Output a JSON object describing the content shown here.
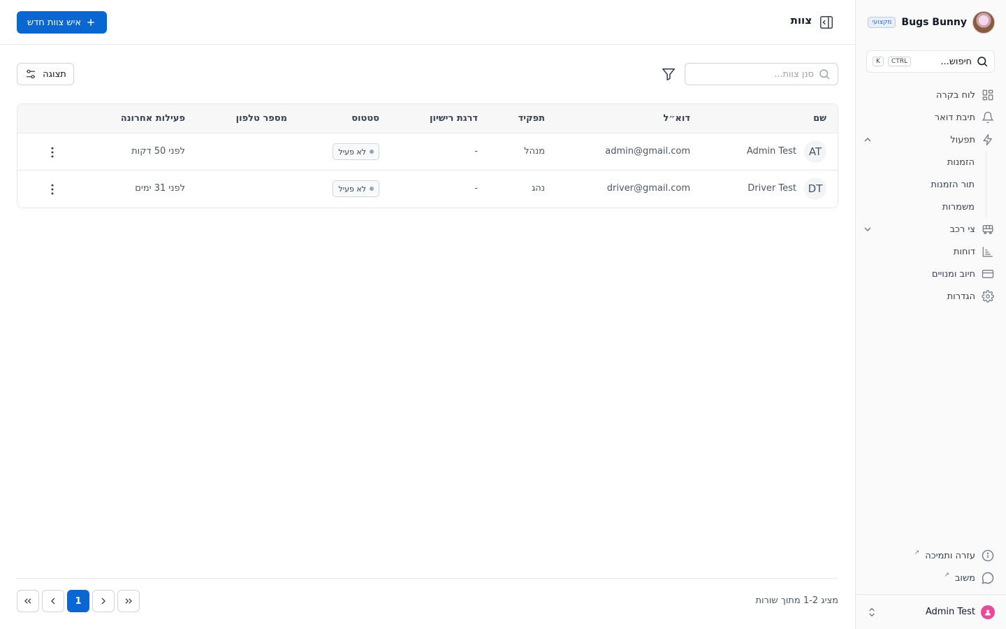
{
  "brand": {
    "name": "Bugs Bunny",
    "badge": "מקצועי"
  },
  "search": {
    "label": "חיפוש...",
    "kbd_ctrl": "CTRL",
    "kbd_k": "K"
  },
  "nav": {
    "dashboard": "לוח בקרה",
    "inbox": "תיבת דואר",
    "operations": "תפעול",
    "operations_sub": [
      "הזמנות",
      "תור הזמנות",
      "משמרות"
    ],
    "fleet": "צי רכב",
    "reports": "דוחות",
    "billing": "חיוב ומנויים",
    "settings": "הגדרות"
  },
  "footer": {
    "help": "עזרה ותמיכה",
    "feedback": "משוב",
    "user": "Admin Test"
  },
  "header": {
    "title": "צוות",
    "add_button": "איש צוות חדש"
  },
  "toolbar": {
    "filter_placeholder": "סנן צוות...",
    "view_button": "תצוגה"
  },
  "table": {
    "columns": {
      "name": "שם",
      "email": "דוא״ל",
      "role": "תפקיד",
      "license": "דרגת רישיון",
      "status": "סטטוס",
      "phone": "מספר טלפון",
      "last_activity": "פעילות אחרונה"
    },
    "rows": [
      {
        "initials": "AT",
        "name": "Admin Test",
        "email": "admin@gmail.com",
        "role": "מנהל",
        "license": "-",
        "status": "לא פעיל",
        "phone": "",
        "last_activity": "לפני 50 דקות"
      },
      {
        "initials": "DT",
        "name": "Driver Test",
        "email": "driver@gmail.com",
        "role": "נהג",
        "license": "-",
        "status": "לא פעיל",
        "phone": "",
        "last_activity": "לפני 31 ימים"
      }
    ]
  },
  "pagination": {
    "summary": "מציג 1-2 מתוך שורות",
    "current_page": "1"
  }
}
